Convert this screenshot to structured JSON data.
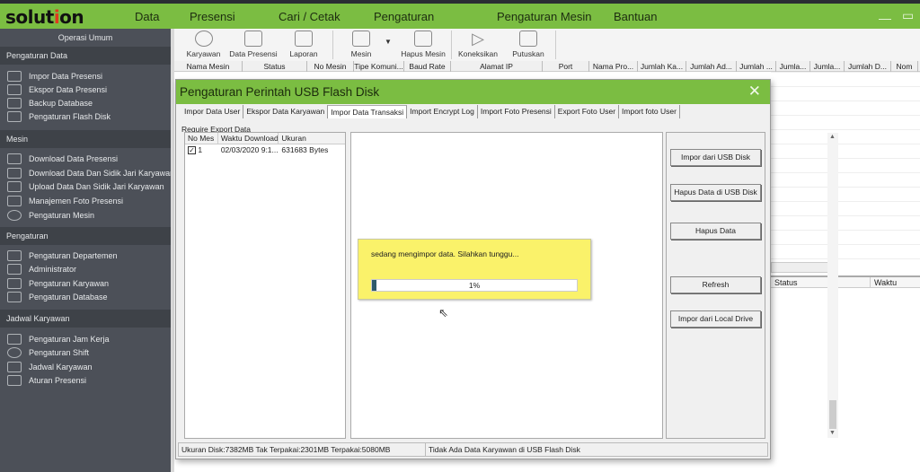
{
  "app": {
    "logo": "solution",
    "menu": [
      "Data",
      "Presensi",
      "Cari / Cetak",
      "Pengaturan",
      "Pengaturan Mesin",
      "Bantuan"
    ],
    "accent": "#7bbd42"
  },
  "sidebar": {
    "header": "Operasi Umum",
    "sections": [
      {
        "title": "Pengaturan Data",
        "items": [
          "Impor Data Presensi",
          "Ekspor Data Presensi",
          "Backup Database",
          "Pengaturan Flash Disk"
        ]
      },
      {
        "title": "Mesin",
        "items": [
          "Download Data Presensi",
          "Download Data Dan Sidik Jari Karyawan",
          "Upload Data Dan Sidik Jari Karyawan",
          "Manajemen Foto Presensi",
          "Pengaturan Mesin"
        ]
      },
      {
        "title": "Pengaturan",
        "items": [
          "Pengaturan Departemen",
          "Administrator",
          "Pengaturan Karyawan",
          "Pengaturan Database"
        ]
      },
      {
        "title": "Jadwal Karyawan",
        "items": [
          "Pengaturan Jam Kerja",
          "Pengaturan Shift",
          "Jadwal Karyawan",
          "Aturan Presensi"
        ]
      }
    ]
  },
  "toolbar": [
    "Karyawan",
    "Data Presensi",
    "Laporan",
    "Mesin",
    "Hapus Mesin",
    "Koneksikan",
    "Putuskan"
  ],
  "columns": [
    "Nama Mesin",
    "Status",
    "No Mesin",
    "Tipe Komuni...",
    "Baud Rate",
    "Alamat IP",
    "Port",
    "Nama Pro...",
    "Jumlah Ka...",
    "Jumlah Ad...",
    "Jumlah ...",
    "Jumla...",
    "Jumla...",
    "Jumlah D...",
    "Nom"
  ],
  "lower_columns": [
    "Status",
    "Waktu"
  ],
  "dialog": {
    "title": "Pengaturan Perintah USB Flash Disk",
    "tabs": [
      "Impor Data User",
      "Ekspor Data Karyawan",
      "Impor Data Transaksi",
      "Import Encrypt Log",
      "Import Foto Presensi",
      "Export Foto User",
      "Import foto User"
    ],
    "active_tab": "Impor Data Transaksi",
    "group": "Require Export Data",
    "list": {
      "headers": [
        "No Mes",
        "Waktu Download",
        "Ukuran"
      ],
      "rows": [
        {
          "checked": true,
          "no": "1",
          "time": "02/03/2020 9:1...",
          "size": "631683 Bytes"
        }
      ]
    },
    "buttons": [
      "Impor dari USB Disk",
      "Hapus Data di USB Disk",
      "Hapus Data",
      "Refresh",
      "Impor dari Local Drive"
    ],
    "progress": {
      "message": "sedang mengimpor data. Silahkan tunggu...",
      "percent": 1,
      "label": "1%"
    },
    "status": {
      "disk": "Ukuran Disk:7382MB  Tak Terpakai:2301MB  Terpakai:5080MB",
      "message": "Tidak Ada Data Karyawan di USB Flash Disk"
    }
  }
}
